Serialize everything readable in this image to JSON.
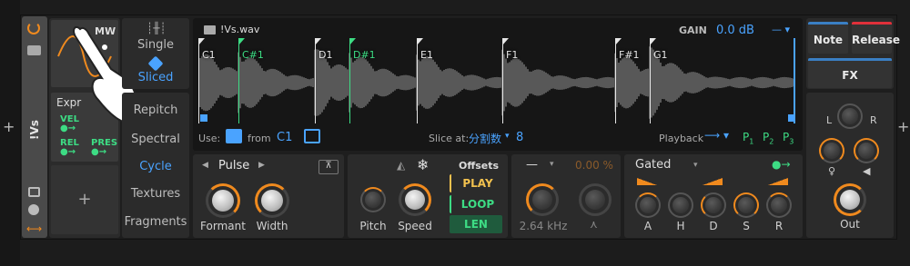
{
  "device": {
    "name": "!Vs",
    "file_name": "!Vs.wav",
    "gain_label": "GAIN",
    "gain_value": "0.0 dB"
  },
  "mod": {
    "mw_label": "MW",
    "expr_label": "Expr",
    "vel": "VEL",
    "rel": "REL",
    "pres": "PRES",
    "add": "+"
  },
  "modes": {
    "single": "Single",
    "sliced": "Sliced"
  },
  "tabs": [
    "Repitch",
    "Spectral",
    "Cycle",
    "Textures",
    "Fragments"
  ],
  "active_tab": "Cycle",
  "slices": [
    "C1",
    "C#1",
    "D1",
    "D#1",
    "E1",
    "F1",
    "F#1",
    "G1"
  ],
  "waveform_footer": {
    "use": "Use:",
    "from": "from",
    "from_note": "C1",
    "slice_at": "Slice at:",
    "slice_mode": "分割数",
    "slice_count": "8",
    "playback": "Playback",
    "p1": "P",
    "p2": "P",
    "p3": "P",
    "p1_sub": "1",
    "p2_sub": "2",
    "p3_sub": "3"
  },
  "pulse": {
    "name": "Pulse",
    "formant": "Formant",
    "width": "Width"
  },
  "playback_section": {
    "pitch": "Pitch",
    "speed": "Speed",
    "offsets": "Offsets",
    "play": "PLAY",
    "loop": "LOOP",
    "len": "LEN"
  },
  "filter": {
    "dash": "—",
    "percent": "0.00 %",
    "freq": "2.64 kHz"
  },
  "envelope": {
    "mode": "Gated",
    "a": "A",
    "h": "H",
    "d": "D",
    "s": "S",
    "r": "R"
  },
  "right": {
    "note": "Note",
    "release": "Release",
    "fx": "FX",
    "l": "L",
    "r": "R",
    "out": "Out"
  },
  "colors": {
    "accent_blue": "#4aa3ff",
    "green": "#3ddc84",
    "orange": "#f08a1e",
    "release_red": "#e0303a",
    "note_blue": "#3a7fc4"
  }
}
